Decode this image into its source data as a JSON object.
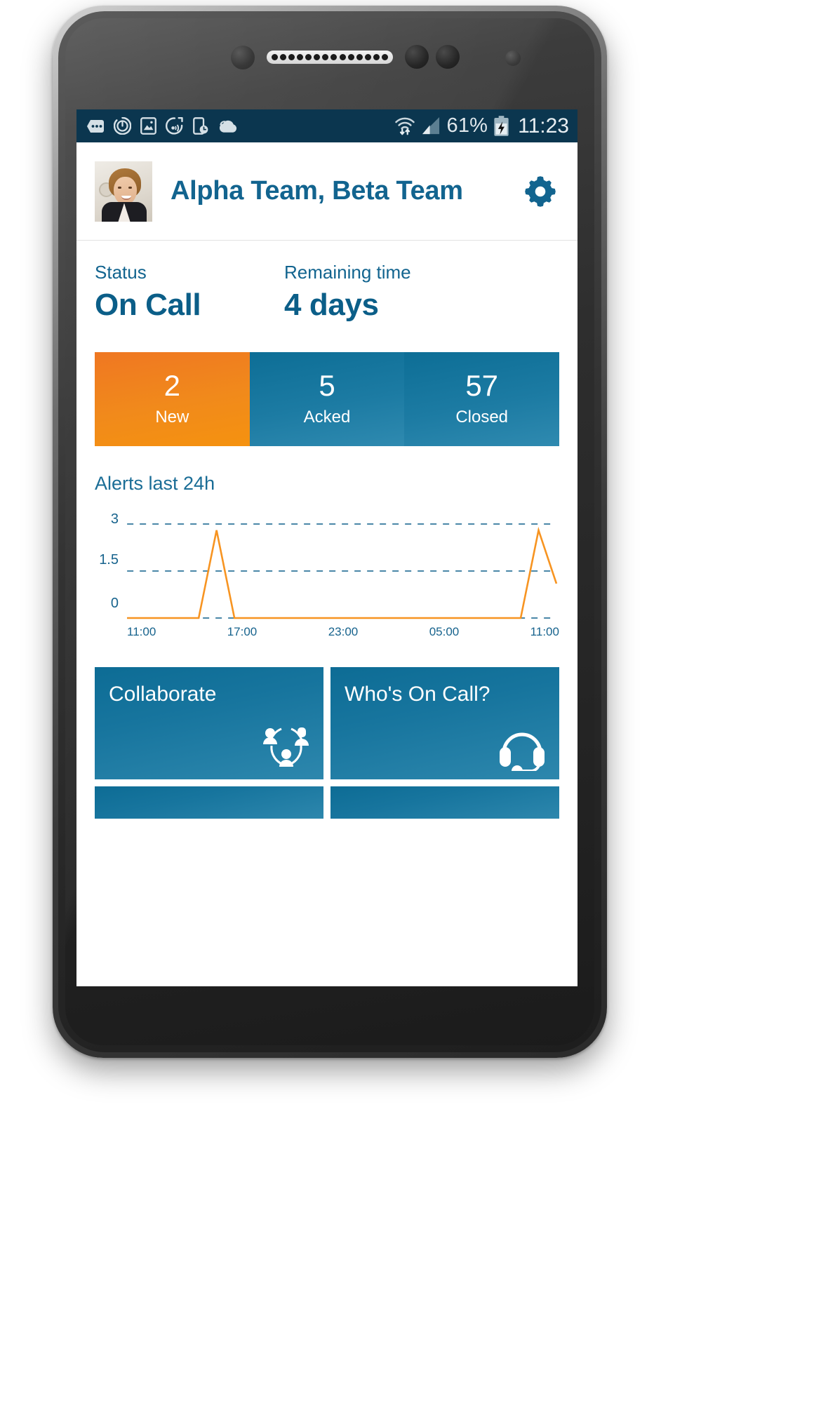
{
  "status_bar": {
    "icons": [
      "messages-icon",
      "power-sync-icon",
      "gallery-icon",
      "sync-signal-icon",
      "phone-clock-icon",
      "cloud-icon"
    ],
    "wifi_icon": "wifi-transfer-icon",
    "signal_icon": "cellular-signal-icon",
    "battery_percent": "61%",
    "battery_icon": "battery-charging-icon",
    "time": "11:23"
  },
  "header": {
    "avatar": "user-avatar",
    "title": "Alpha Team, Beta Team",
    "settings_icon": "gear-icon"
  },
  "overview": {
    "status_label": "Status",
    "status_value": "On Call",
    "remaining_label": "Remaining time",
    "remaining_value": "4 days"
  },
  "counters": [
    {
      "count": "2",
      "label": "New",
      "color": "#f1861c"
    },
    {
      "count": "5",
      "label": "Acked",
      "color": "#1c7ba3"
    },
    {
      "count": "57",
      "label": "Closed",
      "color": "#1c7ba3"
    }
  ],
  "chart_data": {
    "type": "line",
    "title": "Alerts last 24h",
    "xlabel": "",
    "ylabel": "",
    "ylim": [
      0,
      3
    ],
    "yticks": [
      "0",
      "1.5",
      "3"
    ],
    "xticks": [
      "11:00",
      "17:00",
      "23:00",
      "05:00",
      "11:00"
    ],
    "grid": true,
    "line_color": "#f79421",
    "grid_color": "#4a87a8",
    "x": [
      0,
      1,
      2,
      3,
      4,
      5,
      6,
      7,
      8,
      9,
      10,
      11,
      12,
      13,
      14,
      15,
      16,
      17,
      18,
      19,
      20,
      21,
      22,
      23,
      24
    ],
    "x_times": [
      "11:00",
      "12:00",
      "13:00",
      "14:00",
      "15:00",
      "16:00",
      "17:00",
      "18:00",
      "19:00",
      "20:00",
      "21:00",
      "22:00",
      "23:00",
      "00:00",
      "01:00",
      "02:00",
      "03:00",
      "04:00",
      "05:00",
      "06:00",
      "07:00",
      "08:00",
      "09:00",
      "10:00",
      "11:00"
    ],
    "values": [
      0,
      0,
      0,
      0,
      0,
      2.8,
      0,
      0,
      0,
      0,
      0,
      0,
      0,
      0,
      0,
      0,
      0,
      0,
      0,
      0,
      0,
      0,
      0,
      2.8,
      1.1
    ],
    "series": [
      {
        "name": "Alerts",
        "values": [
          0,
          0,
          0,
          0,
          0,
          2.8,
          0,
          0,
          0,
          0,
          0,
          0,
          0,
          0,
          0,
          0,
          0,
          0,
          0,
          0,
          0,
          0,
          0,
          2.8,
          1.1
        ]
      }
    ],
    "gridlines": [
      1.5,
      3
    ]
  },
  "tiles": [
    {
      "label": "Collaborate",
      "icon": "people-network-icon"
    },
    {
      "label": "Who's On Call?",
      "icon": "headset-icon"
    }
  ]
}
